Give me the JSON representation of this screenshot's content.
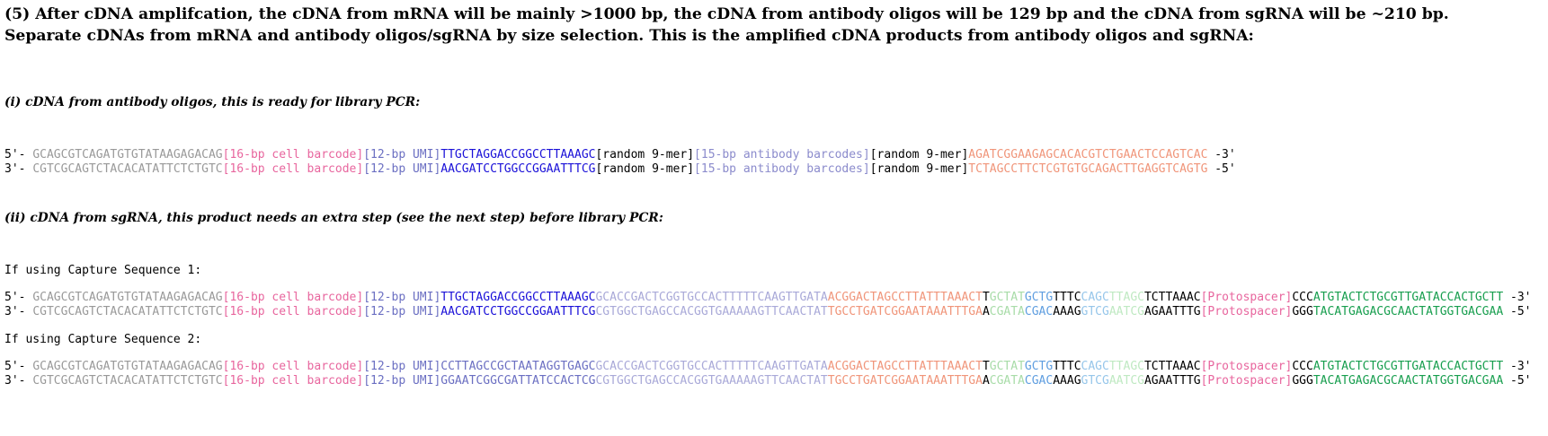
{
  "heading": {
    "line1": "(5) After cDNA amplifcation, the cDNA from mRNA will be mainly >1000 bp, the cDNA from antibody oligos will be 129 bp and the cDNA from sgRNA will be ~210 bp.",
    "line2": "Separate cDNAs from mRNA and antibody oligos/sgRNA by size selection. This is the amplified cDNA products from antibody oligos and sgRNA:"
  },
  "section_i": {
    "title": "(i) cDNA from antibody oligos, this is ready for library PCR:"
  },
  "section_ii": {
    "title": "(ii) cDNA from sgRNA, this product needs an extra step (see the next step) before library PCR:"
  },
  "capture1": {
    "label": "If using Capture Sequence 1:"
  },
  "capture2": {
    "label": "If using Capture Sequence 2:"
  },
  "colors": {
    "black": "#000000",
    "gray": "#999999",
    "pink": "#e8669e",
    "slate": "#6b6fc2",
    "blue": "#1a10d8",
    "periwinkle": "#8b8bcc",
    "salmon": "#f0957a",
    "lavender": "#a9a9d8",
    "pale_green": "#a8dca8",
    "sky": "#5f9ee0",
    "light_sky": "#96c6ea",
    "pale_blue": "#a8d4f0",
    "pale_mint": "#bfe9c2",
    "green": "#179e4e"
  },
  "sequences": [
    {
      "name": "i-top",
      "segments": [
        {
          "text": "5'- ",
          "color": "black"
        },
        {
          "text": "GCAGCGTCAGATGTGTATAAGAGACAG",
          "color": "gray"
        },
        {
          "text": "[16-bp cell barcode]",
          "color": "pink"
        },
        {
          "text": "[12-bp UMI]",
          "color": "slate"
        },
        {
          "text": "TTGCTAGGACCGGCCTTAAAGC",
          "color": "blue"
        },
        {
          "text": "[random 9-mer]",
          "color": "black"
        },
        {
          "text": "[15-bp antibody barcodes]",
          "color": "periwinkle"
        },
        {
          "text": "[random 9-mer]",
          "color": "black"
        },
        {
          "text": "AGATCGGAAGAGCACACGTCTGAACTCCAGTCAC",
          "color": "salmon"
        },
        {
          "text": " -3'",
          "color": "black"
        }
      ]
    },
    {
      "name": "i-bottom",
      "segments": [
        {
          "text": "3'- ",
          "color": "black"
        },
        {
          "text": "CGTCGCAGTCTACACATATTCTCTGTC",
          "color": "gray"
        },
        {
          "text": "[16-bp cell barcode]",
          "color": "pink"
        },
        {
          "text": "[12-bp UMI]",
          "color": "slate"
        },
        {
          "text": "AACGATCCTGGCCGGAATTTCG",
          "color": "blue"
        },
        {
          "text": "[random 9-mer]",
          "color": "black"
        },
        {
          "text": "[15-bp antibody barcodes]",
          "color": "periwinkle"
        },
        {
          "text": "[random 9-mer]",
          "color": "black"
        },
        {
          "text": "TCTAGCCTTCTCGTGTGCAGACTTGAGGTCAGTG",
          "color": "salmon"
        },
        {
          "text": " -5'",
          "color": "black"
        }
      ]
    },
    {
      "name": "cs1-top",
      "segments": [
        {
          "text": "5'- ",
          "color": "black"
        },
        {
          "text": "GCAGCGTCAGATGTGTATAAGAGACAG",
          "color": "gray"
        },
        {
          "text": "[16-bp cell barcode]",
          "color": "pink"
        },
        {
          "text": "[12-bp UMI]",
          "color": "slate"
        },
        {
          "text": "TTGCTAGGACCGGCCTTAAAGC",
          "color": "blue"
        },
        {
          "text": "GCACCGACTCGGTGCCACTTTTTCAAGTTGATA",
          "color": "lavender"
        },
        {
          "text": "ACGGACTAGCCTTATTTAAACT",
          "color": "salmon"
        },
        {
          "text": "T",
          "color": "black"
        },
        {
          "text": "GCTAT",
          "color": "pale_green"
        },
        {
          "text": "GCTG",
          "color": "sky"
        },
        {
          "text": "TTTC",
          "color": "black"
        },
        {
          "text": "CAGC",
          "color": "light_sky"
        },
        {
          "text": "TTAGC",
          "color": "pale_mint"
        },
        {
          "text": "TCTTAAAC",
          "color": "black"
        },
        {
          "text": "[Protospacer]",
          "color": "pink"
        },
        {
          "text": "CCC",
          "color": "black"
        },
        {
          "text": "ATGTACTCTGCGTTGATACCACTGCTT",
          "color": "green"
        },
        {
          "text": " -3'",
          "color": "black"
        }
      ]
    },
    {
      "name": "cs1-bottom",
      "segments": [
        {
          "text": "3'- ",
          "color": "black"
        },
        {
          "text": "CGTCGCAGTCTACACATATTCTCTGTC",
          "color": "gray"
        },
        {
          "text": "[16-bp cell barcode]",
          "color": "pink"
        },
        {
          "text": "[12-bp UMI]",
          "color": "slate"
        },
        {
          "text": "AACGATCCTGGCCGGAATTTCG",
          "color": "blue"
        },
        {
          "text": "CGTGGCTGAGCCACGGTGAAAAAGTTCAACTAT",
          "color": "lavender"
        },
        {
          "text": "TGCCTGATCGGAATAAATTTGA",
          "color": "salmon"
        },
        {
          "text": "A",
          "color": "black"
        },
        {
          "text": "CGATA",
          "color": "pale_green"
        },
        {
          "text": "CGAC",
          "color": "sky"
        },
        {
          "text": "AAAG",
          "color": "black"
        },
        {
          "text": "GTCG",
          "color": "light_sky"
        },
        {
          "text": "AATCG",
          "color": "pale_mint"
        },
        {
          "text": "AGAATTTG",
          "color": "black"
        },
        {
          "text": "[Protospacer]",
          "color": "pink"
        },
        {
          "text": "GGG",
          "color": "black"
        },
        {
          "text": "TACATGAGACGCAACTATGGTGACGAA",
          "color": "green"
        },
        {
          "text": " -5'",
          "color": "black"
        }
      ]
    },
    {
      "name": "cs2-top",
      "segments": [
        {
          "text": "5'- ",
          "color": "black"
        },
        {
          "text": "GCAGCGTCAGATGTGTATAAGAGACAG",
          "color": "gray"
        },
        {
          "text": "[16-bp cell barcode]",
          "color": "pink"
        },
        {
          "text": "[12-bp UMI]",
          "color": "slate"
        },
        {
          "text": "CCTTAGCCGCTAATAGGTGAGC",
          "color": "slate"
        },
        {
          "text": "GCACCGACTCGGTGCCACTTTTTCAAGTTGATA",
          "color": "lavender"
        },
        {
          "text": "ACGGACTAGCCTTATTTAAACT",
          "color": "salmon"
        },
        {
          "text": "T",
          "color": "black"
        },
        {
          "text": "GCTAT",
          "color": "pale_green"
        },
        {
          "text": "GCTG",
          "color": "sky"
        },
        {
          "text": "TTTC",
          "color": "black"
        },
        {
          "text": "CAGC",
          "color": "light_sky"
        },
        {
          "text": "TTAGC",
          "color": "pale_mint"
        },
        {
          "text": "TCTTAAAC",
          "color": "black"
        },
        {
          "text": "[Protospacer]",
          "color": "pink"
        },
        {
          "text": "CCC",
          "color": "black"
        },
        {
          "text": "ATGTACTCTGCGTTGATACCACTGCTT",
          "color": "green"
        },
        {
          "text": " -3'",
          "color": "black"
        }
      ]
    },
    {
      "name": "cs2-bottom",
      "segments": [
        {
          "text": "3'- ",
          "color": "black"
        },
        {
          "text": "CGTCGCAGTCTACACATATTCTCTGTC",
          "color": "gray"
        },
        {
          "text": "[16-bp cell barcode]",
          "color": "pink"
        },
        {
          "text": "[12-bp UMI]",
          "color": "slate"
        },
        {
          "text": "GGAATCGGCGATTATCCACTCG",
          "color": "slate"
        },
        {
          "text": "CGTGGCTGAGCCACGGTGAAAAAGTTCAACTAT",
          "color": "lavender"
        },
        {
          "text": "TGCCTGATCGGAATAAATTTGA",
          "color": "salmon"
        },
        {
          "text": "A",
          "color": "black"
        },
        {
          "text": "CGATA",
          "color": "pale_green"
        },
        {
          "text": "CGAC",
          "color": "sky"
        },
        {
          "text": "AAAG",
          "color": "black"
        },
        {
          "text": "GTCG",
          "color": "light_sky"
        },
        {
          "text": "AATCG",
          "color": "pale_mint"
        },
        {
          "text": "AGAATTTG",
          "color": "black"
        },
        {
          "text": "[Protospacer]",
          "color": "pink"
        },
        {
          "text": "GGG",
          "color": "black"
        },
        {
          "text": "TACATGAGACGCAACTATGGTGACGAA",
          "color": "green"
        },
        {
          "text": " -5'",
          "color": "black"
        }
      ]
    }
  ]
}
